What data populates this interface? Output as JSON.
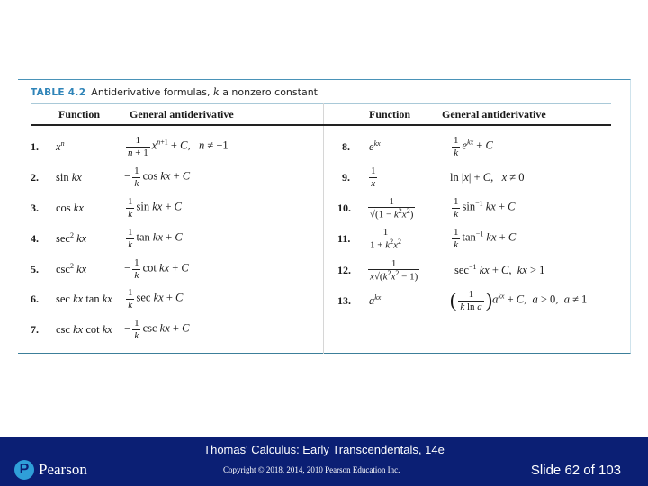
{
  "table": {
    "tag": "TABLE 4.2",
    "title_prefix": "Antiderivative formulas, ",
    "title_var": "k",
    "title_suffix": " a nonzero constant",
    "headers": {
      "left_function": "Function",
      "left_antiderivative": "General antiderivative",
      "right_function": "Function",
      "right_antiderivative": "General antiderivative"
    },
    "rows": [
      {
        "num": "1.",
        "function": "x^n",
        "antiderivative": "1/(n+1) x^(n+1) + C,  n ≠ −1"
      },
      {
        "num": "2.",
        "function": "sin kx",
        "antiderivative": "−(1/k) cos kx + C"
      },
      {
        "num": "3.",
        "function": "cos kx",
        "antiderivative": "(1/k) sin kx + C"
      },
      {
        "num": "4.",
        "function": "sec² kx",
        "antiderivative": "(1/k) tan kx + C"
      },
      {
        "num": "5.",
        "function": "csc² kx",
        "antiderivative": "−(1/k) cot kx + C"
      },
      {
        "num": "6.",
        "function": "sec kx tan kx",
        "antiderivative": "(1/k) sec kx + C"
      },
      {
        "num": "7.",
        "function": "csc kx cot kx",
        "antiderivative": "−(1/k) csc kx + C"
      },
      {
        "num": "8.",
        "function": "e^(kx)",
        "antiderivative": "(1/k) e^(kx) + C"
      },
      {
        "num": "9.",
        "function": "1/x",
        "antiderivative": "ln|x| + C,  x ≠ 0"
      },
      {
        "num": "10.",
        "function": "1/√(1 − k²x²)",
        "antiderivative": "(1/k) sin⁻¹ kx + C"
      },
      {
        "num": "11.",
        "function": "1/(1 + k²x²)",
        "antiderivative": "(1/k) tan⁻¹ kx + C"
      },
      {
        "num": "12.",
        "function": "1/(x√(k²x² − 1))",
        "antiderivative": "sec⁻¹ kx + C,  kx > 1"
      },
      {
        "num": "13.",
        "function": "a^(kx)",
        "antiderivative": "(1/(k ln a)) a^(kx) + C,  a > 0, a ≠ 1"
      }
    ]
  },
  "footer": {
    "book_title": "Thomas' Calculus: Early Transcendentals, 14e",
    "copyright": "Copyright © 2018, 2014, 2010 Pearson Education Inc.",
    "slide": "Slide 62 of 103",
    "logo_text": "Pearson",
    "logo_mark": "P",
    "background_color": "#0b1f74",
    "logo_color": "#2f9fd8"
  }
}
